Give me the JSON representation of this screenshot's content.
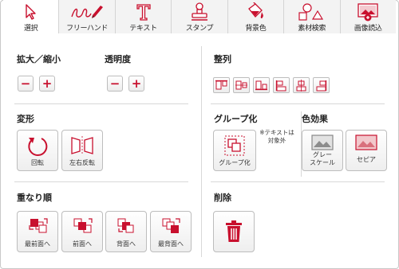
{
  "tabs": [
    {
      "label": "選択",
      "icon": "cursor-icon",
      "active": true
    },
    {
      "label": "フリーハンド",
      "icon": "pen-scribble-icon",
      "active": false
    },
    {
      "label": "テキスト",
      "icon": "text-t-icon",
      "active": false
    },
    {
      "label": "スタンプ",
      "icon": "stamp-icon",
      "active": false
    },
    {
      "label": "背景色",
      "icon": "paint-bucket-icon",
      "active": false
    },
    {
      "label": "素材検索",
      "icon": "shapes-icon",
      "active": false
    },
    {
      "label": "画像読込",
      "icon": "image-load-icon",
      "active": false
    }
  ],
  "zoom": {
    "title": "拡大／縮小",
    "minus": "−",
    "plus": "+"
  },
  "opacity": {
    "title": "透明度",
    "minus": "−",
    "plus": "+"
  },
  "align": {
    "title": "整列",
    "icons": [
      "align-top-icon",
      "align-middle-icon",
      "align-bottom-icon",
      "align-left-icon",
      "align-center-icon",
      "align-right-icon"
    ]
  },
  "transform": {
    "title": "変形",
    "rotate_label": "回転",
    "flip_label": "左右反転"
  },
  "group": {
    "title": "グループ化",
    "button_label": "グループ化",
    "note_line1": "※テキストは",
    "note_line2": "対象外"
  },
  "color_effect": {
    "title": "色効果",
    "grayscale_line1": "グレー",
    "grayscale_line2": "スケール",
    "sepia_label": "セピア"
  },
  "order": {
    "title": "重なり順",
    "front_most": "最前面へ",
    "front": "前面へ",
    "back": "背面へ",
    "back_most": "最背面へ"
  },
  "delete": {
    "title": "削除"
  },
  "colors": {
    "accent": "#c8102e",
    "border": "#bdbdbd",
    "divider": "#d8d8d8"
  }
}
